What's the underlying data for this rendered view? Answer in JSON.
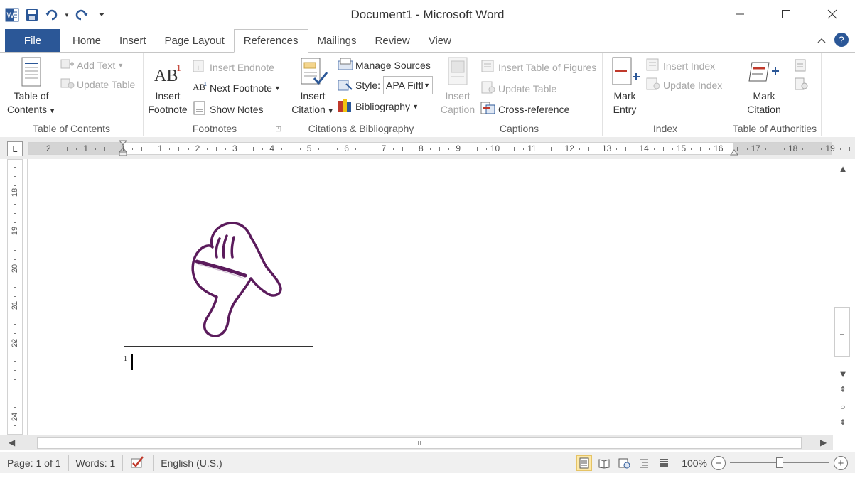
{
  "window": {
    "title": "Document1 - Microsoft Word",
    "app_icon_letter": "W"
  },
  "tabs": [
    {
      "label": "File",
      "kind": "file"
    },
    {
      "label": "Home"
    },
    {
      "label": "Insert"
    },
    {
      "label": "Page Layout"
    },
    {
      "label": "References",
      "active": true
    },
    {
      "label": "Mailings"
    },
    {
      "label": "Review"
    },
    {
      "label": "View"
    }
  ],
  "ribbon": {
    "toc": {
      "group": "Table of Contents",
      "table_of_contents_1": "Table of",
      "table_of_contents_2": "Contents",
      "add_text": "Add Text",
      "update_table": "Update Table"
    },
    "footnotes": {
      "group": "Footnotes",
      "insert_footnote_1": "Insert",
      "insert_footnote_2": "Footnote",
      "insert_endnote": "Insert Endnote",
      "next_footnote": "Next Footnote",
      "show_notes": "Show Notes"
    },
    "citations": {
      "group": "Citations & Bibliography",
      "insert_citation_1": "Insert",
      "insert_citation_2": "Citation",
      "manage_sources": "Manage Sources",
      "style_label": "Style:",
      "style_value": "APA Fifth",
      "bibliography": "Bibliography"
    },
    "captions": {
      "group": "Captions",
      "insert_caption_1": "Insert",
      "insert_caption_2": "Caption",
      "insert_table_of_figures": "Insert Table of Figures",
      "update_table": "Update Table",
      "cross_reference": "Cross-reference"
    },
    "index": {
      "group": "Index",
      "mark_entry_1": "Mark",
      "mark_entry_2": "Entry",
      "insert_index": "Insert Index",
      "update_index": "Update Index"
    },
    "authorities": {
      "group": "Table of Authorities",
      "mark_citation_1": "Mark",
      "mark_citation_2": "Citation"
    }
  },
  "ruler": {
    "h_labels": [
      "2",
      "1",
      "1",
      "1",
      "2",
      "3",
      "4",
      "5",
      "6",
      "7",
      "8",
      "9",
      "10",
      "11",
      "12",
      "13",
      "14",
      "15",
      "16",
      "17",
      "18",
      "19"
    ],
    "v_labels": [
      "18",
      "19",
      "20",
      "21",
      "22",
      "24"
    ],
    "tab_button": "L"
  },
  "document": {
    "footnote_number": "1"
  },
  "status": {
    "page": "Page: 1 of 1",
    "words": "Words: 1",
    "language": "English (U.S.)",
    "zoom": "100%",
    "zoom_level_fraction": 0.5
  },
  "colors": {
    "file_tab": "#2b5797",
    "hand_outline": "#5b1b5c",
    "active_view": "#fde9a9"
  }
}
